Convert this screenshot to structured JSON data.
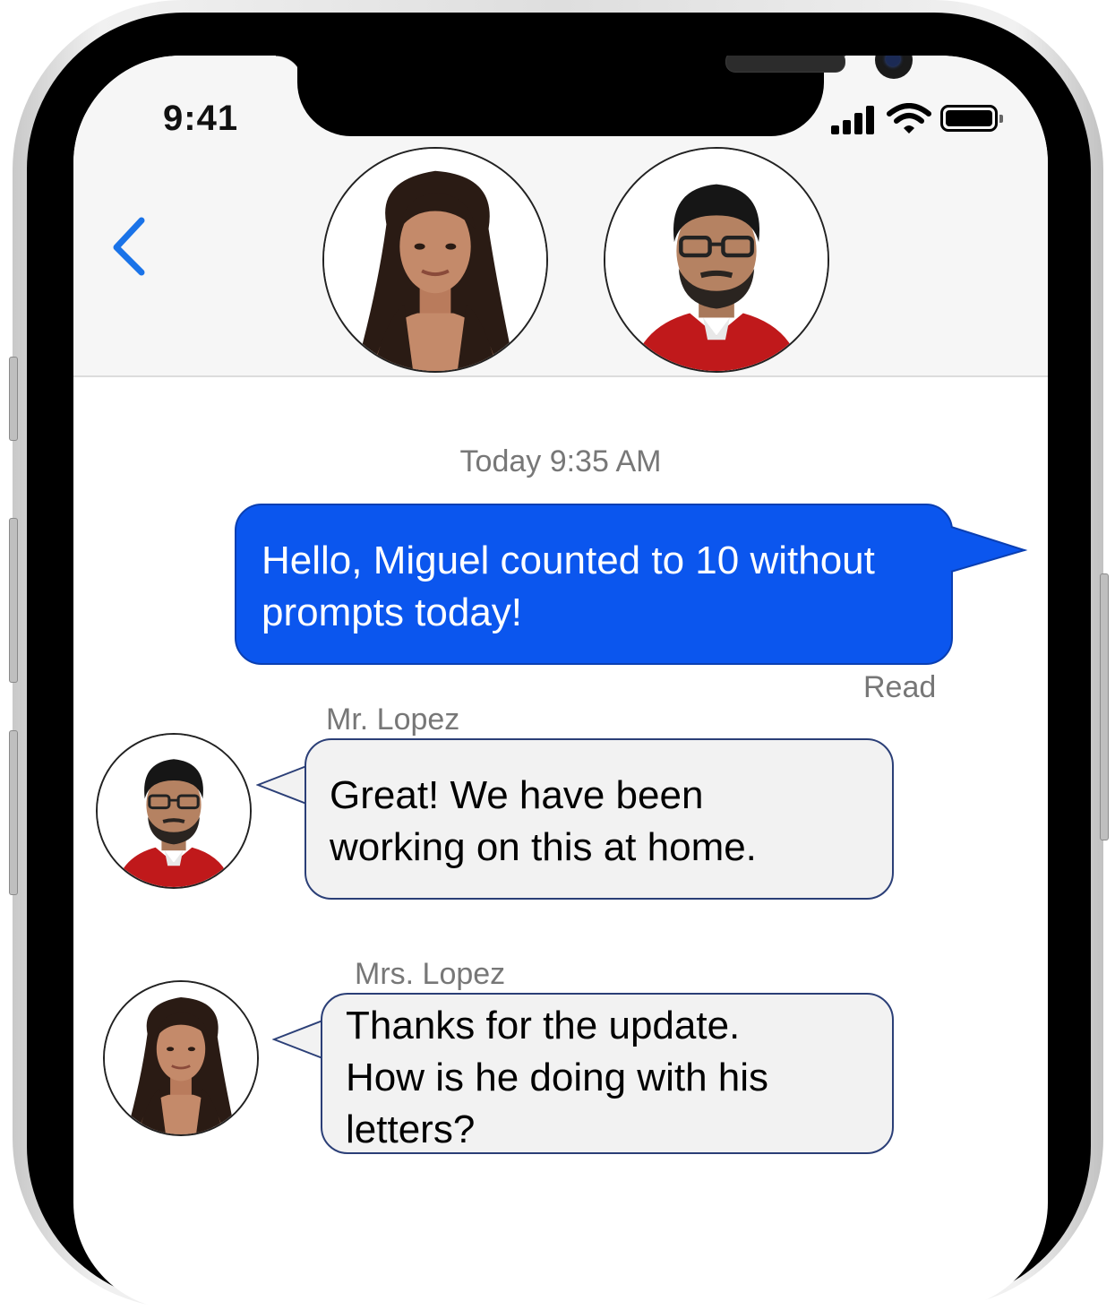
{
  "status_bar": {
    "time": "9:41"
  },
  "header": {
    "back_icon": "chevron-left-icon",
    "participants": [
      "woman-portrait",
      "man-portrait"
    ]
  },
  "conversation": {
    "timestamp": "Today 9:35 AM",
    "messages": [
      {
        "direction": "outgoing",
        "line1": "Hello, Miguel counted to 10 without",
        "line2": "prompts today!",
        "status": "Read"
      },
      {
        "direction": "incoming",
        "sender": "Mr. Lopez",
        "line1": "Great! We have been",
        "line2": "working on this at home."
      },
      {
        "direction": "incoming",
        "sender": "Mrs. Lopez",
        "line1": "Thanks for the update.",
        "line2": "How is he doing with his",
        "line3": "letters?"
      }
    ]
  },
  "colors": {
    "outgoing_bubble": "#0b56ee",
    "incoming_bubble": "#f2f2f2",
    "accent": "#1a73e8"
  }
}
